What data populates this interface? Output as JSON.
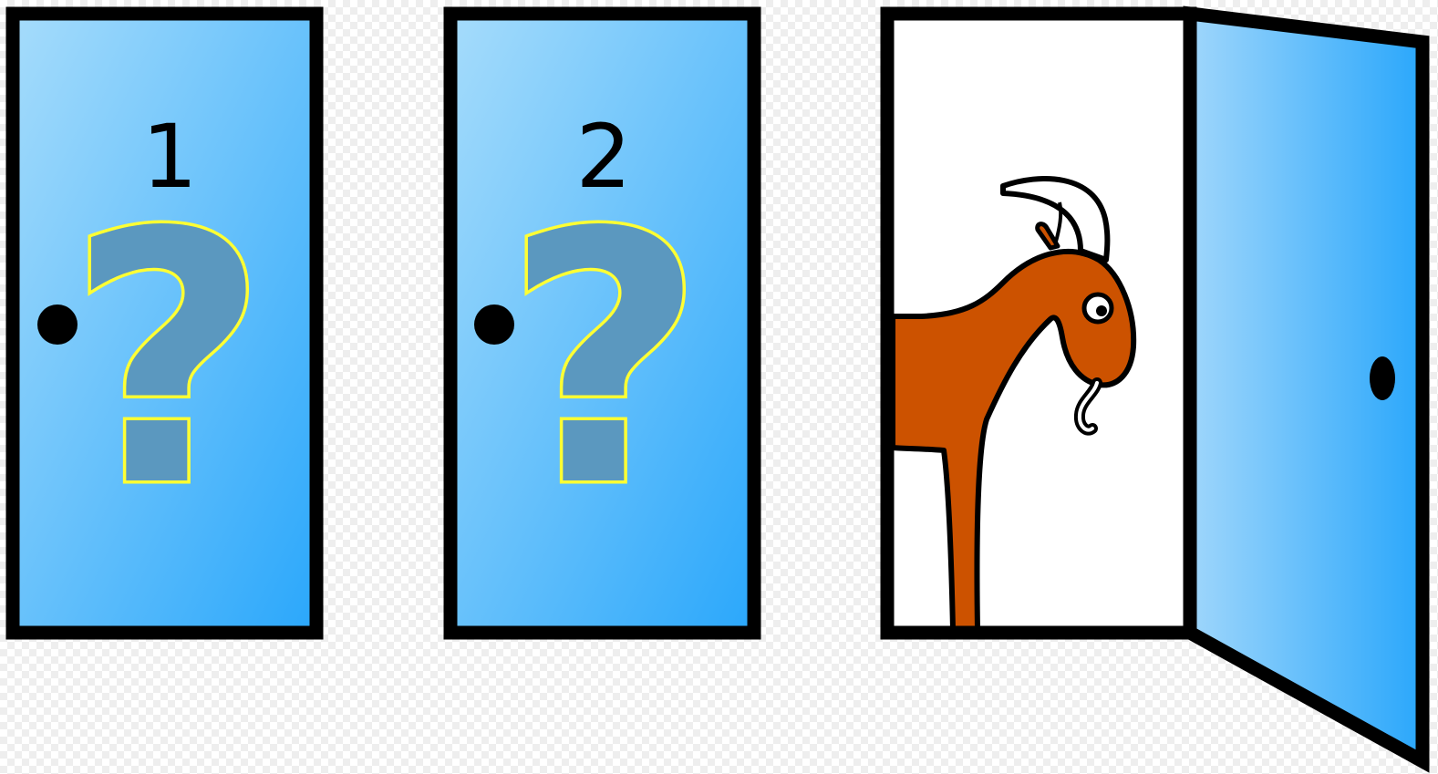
{
  "doors": [
    {
      "number": "1",
      "state": "closed",
      "mark": "?"
    },
    {
      "number": "2",
      "state": "closed",
      "mark": "?"
    },
    {
      "number": "",
      "state": "open",
      "reveals": "goat"
    }
  ],
  "colors": {
    "door_light": "#a6dcfb",
    "door_dark": "#2aa7fb",
    "outline": "#000000",
    "question_fill": "#5b98bf",
    "question_stroke": "#ffff33",
    "goat_body": "#cc5200",
    "horn": "#ffffff"
  }
}
